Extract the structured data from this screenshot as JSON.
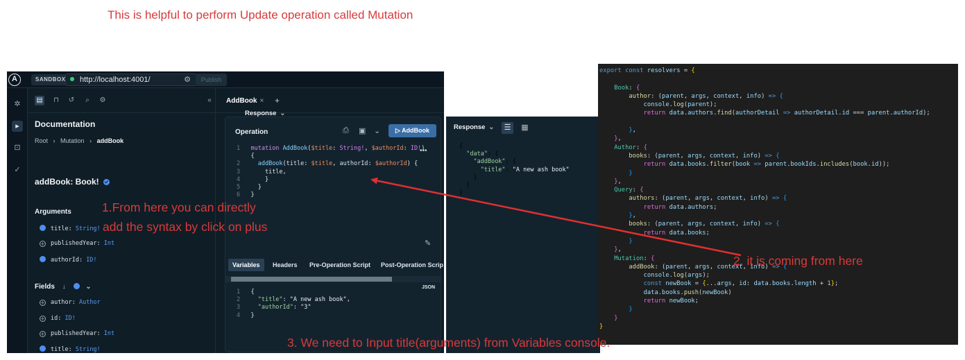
{
  "annotations": {
    "headline": "This is helpful to perform Update operation called Mutation",
    "step1_line1": "1.From here you can directly",
    "step1_line2": "add the syntax by click on plus",
    "step2": "2. it is coming from here",
    "step3": "3. We need to  Input title(arguments) from Variables console."
  },
  "sandbox": {
    "badge": "SANDBOX",
    "url": "http://localhost:4001/",
    "publish": "Publish",
    "doc_title": "Documentation",
    "breadcrumb": [
      "Root",
      "Mutation",
      "addBook"
    ],
    "field_name": "addBook: Book!",
    "arguments_label": "Arguments",
    "arguments": [
      {
        "name": "title:",
        "type": "String!",
        "checked": true
      },
      {
        "name": "publishedYear:",
        "type": "Int",
        "checked": false
      },
      {
        "name": "authorId:",
        "type": "ID!",
        "checked": true
      }
    ],
    "fields_label": "Fields",
    "fields": [
      {
        "name": "author:",
        "type": "Author",
        "checked": false
      },
      {
        "name": "id:",
        "type": "ID!",
        "checked": false
      },
      {
        "name": "publishedYear:",
        "type": "Int",
        "checked": false
      },
      {
        "name": "title:",
        "type": "String!",
        "checked": true
      }
    ],
    "tab_label": "AddBook",
    "operation_label": "Operation",
    "run_button": "▷ AddBook",
    "response_label": "Response",
    "variables_tabs": [
      "Variables",
      "Headers",
      "Pre-Operation Script",
      "Post-Operation Scrip"
    ],
    "json_badge": "JSON"
  },
  "colors": {
    "annotation": "#d93a3a",
    "sandbox_bg": "#0f1d26",
    "editor_bg": "#1e1e1e",
    "arrow": "#e03030"
  }
}
